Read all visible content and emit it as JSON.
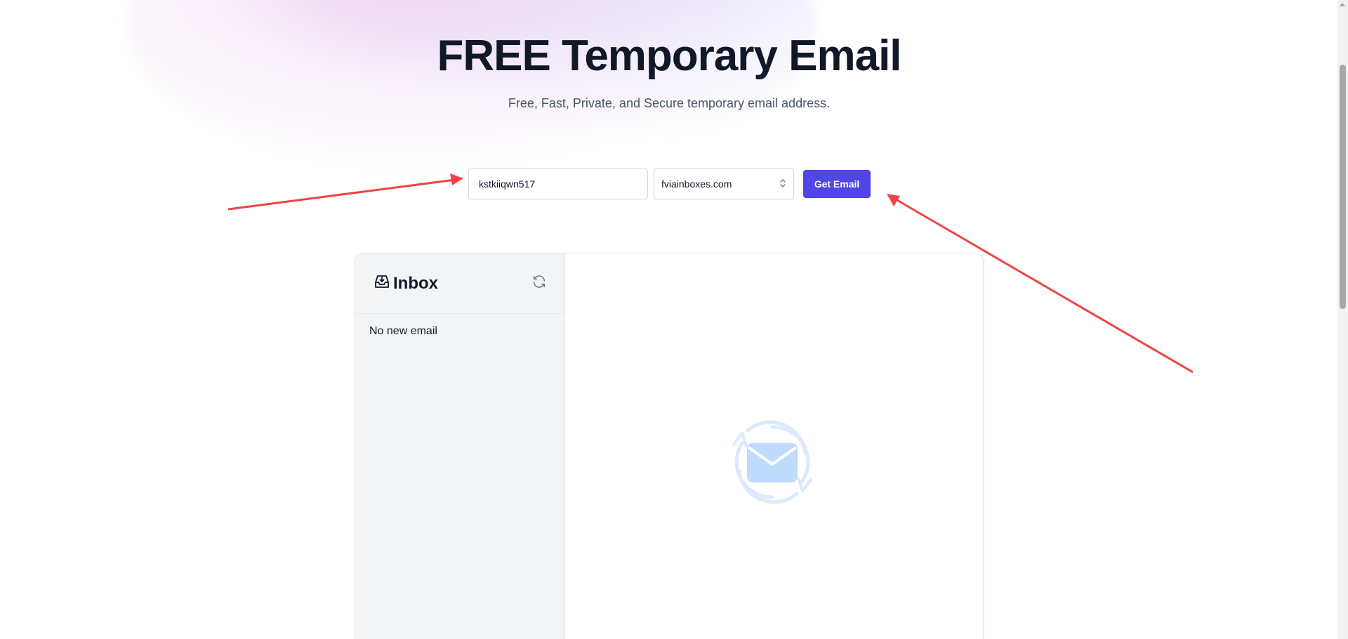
{
  "hero": {
    "title": "FREE Temporary Email",
    "subtitle": "Free, Fast, Private, and Secure temporary email address."
  },
  "form": {
    "username_value": "kstkiiqwn517",
    "domain_value": "fviainboxes.com",
    "submit_label": "Get Email"
  },
  "inbox": {
    "title": "Inbox",
    "empty_message": "No new email"
  },
  "colors": {
    "accent": "#4f46e5",
    "annotation_arrow": "#ef4444",
    "illustration": "#bfdbfe"
  },
  "icons": {
    "inbox": "inbox-icon",
    "refresh": "refresh-icon",
    "select_chevron": "chevron-updown-icon",
    "empty_state": "mail-sync-icon"
  }
}
